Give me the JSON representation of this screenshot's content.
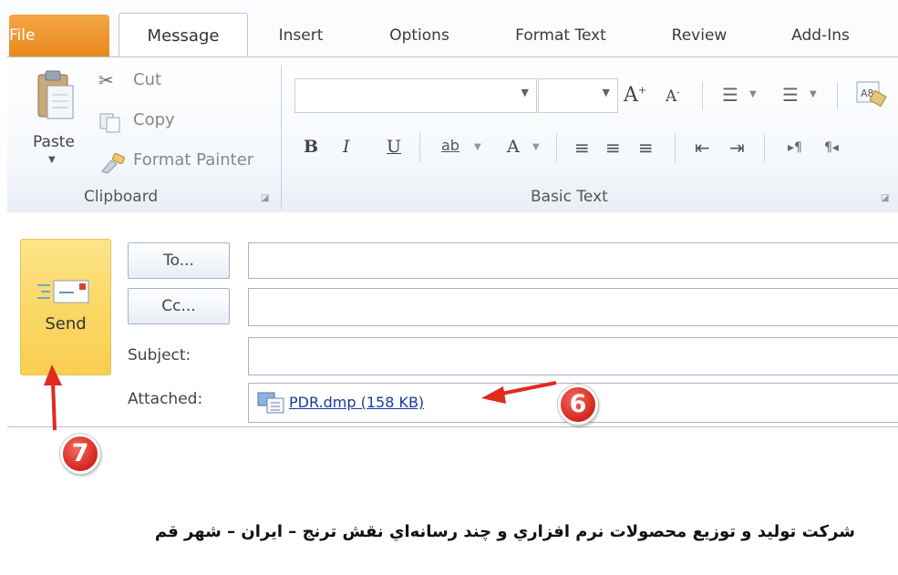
{
  "tabs": {
    "file": "File",
    "message": "Message",
    "insert": "Insert",
    "options": "Options",
    "format_text": "Format Text",
    "review": "Review",
    "add_ins": "Add-Ins"
  },
  "clipboard": {
    "paste": "Paste",
    "cut": "Cut",
    "copy": "Copy",
    "format_painter": "Format Painter",
    "group_label": "Clipboard"
  },
  "basic_text": {
    "group_label": "Basic Text",
    "bold": "B",
    "italic": "I",
    "underline": "U",
    "highlight": "ab",
    "font_color": "A"
  },
  "compose": {
    "send": "Send",
    "to_button": "To...",
    "cc_button": "Cc...",
    "subject_label": "Subject:",
    "attached_label": "Attached:",
    "to_value": "",
    "cc_value": "",
    "subject_value": "",
    "attachment": "PDR.dmp (158 KB)",
    "body_text": "شرکت تولید و توزیع محصولات نرم افزاري و چند رسانه‌اي نقش ترنج – ایران – شهر قم"
  },
  "annotations": {
    "step6": "6",
    "step7": "7",
    "arrow_color": "#e02a20"
  },
  "colors": {
    "file_tab": "#e88a1d",
    "send_button": "#fbd866"
  }
}
